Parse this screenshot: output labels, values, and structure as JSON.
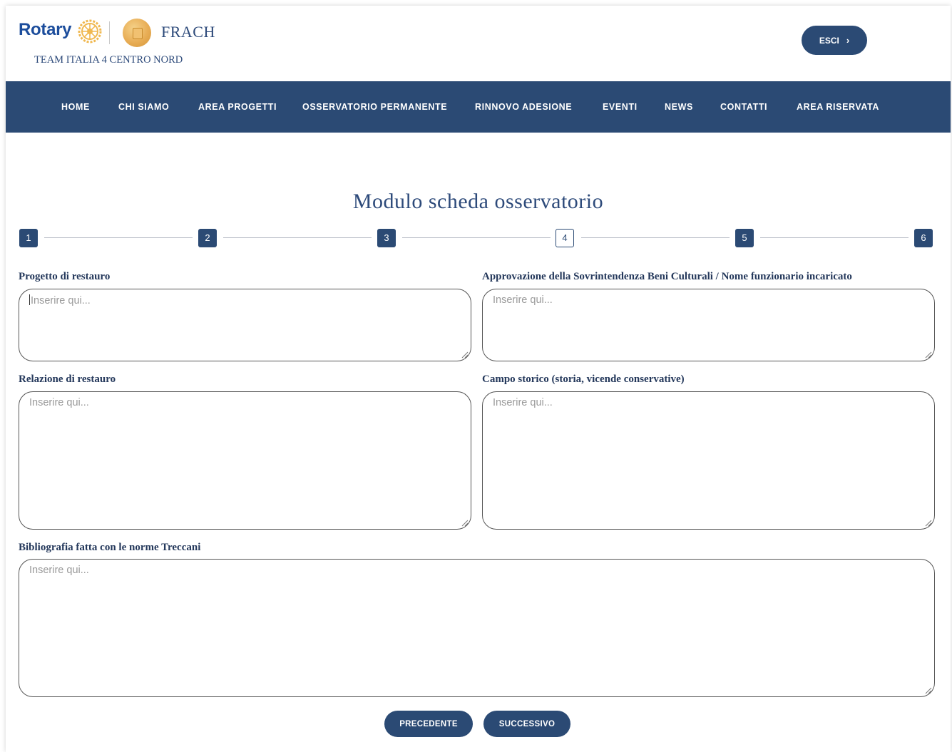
{
  "header": {
    "logo_rotary": "Rotary",
    "logo_frach": "FRACH",
    "logo_team": "TEAM ITALIA 4 CENTRO NORD",
    "esci_label": "ESCI"
  },
  "nav": {
    "items": [
      "HOME",
      "CHI SIAMO",
      "AREA PROGETTI",
      "OSSERVATORIO PERMANENTE",
      "RINNOVO ADESIONE",
      "EVENTI",
      "NEWS",
      "CONTATTI",
      "AREA RISERVATA"
    ]
  },
  "form": {
    "title": "Modulo scheda osservatorio",
    "steps": [
      "1",
      "2",
      "3",
      "4",
      "5",
      "6"
    ],
    "active_step": 4,
    "fields": {
      "progetto": {
        "label": "Progetto di restauro",
        "placeholder": "Inserire qui..."
      },
      "approvazione": {
        "label": "Approvazione della Sovrintendenza Beni Culturali / Nome funzionario incaricato",
        "placeholder": "Inserire qui..."
      },
      "relazione": {
        "label": "Relazione di restauro",
        "placeholder": "Inserire qui..."
      },
      "campo_storico": {
        "label": "Campo storico (storia, vicende conservative)",
        "placeholder": "Inserire qui..."
      },
      "bibliografia": {
        "label": "Bibliografia fatta con le norme Treccani",
        "placeholder": "Inserire qui..."
      }
    },
    "buttons": {
      "prev": "PRECEDENTE",
      "next": "SUCCESSIVO"
    }
  },
  "colors": {
    "primary": "#2b4a74",
    "text": "#24385b",
    "gold": "#e8ad55"
  }
}
